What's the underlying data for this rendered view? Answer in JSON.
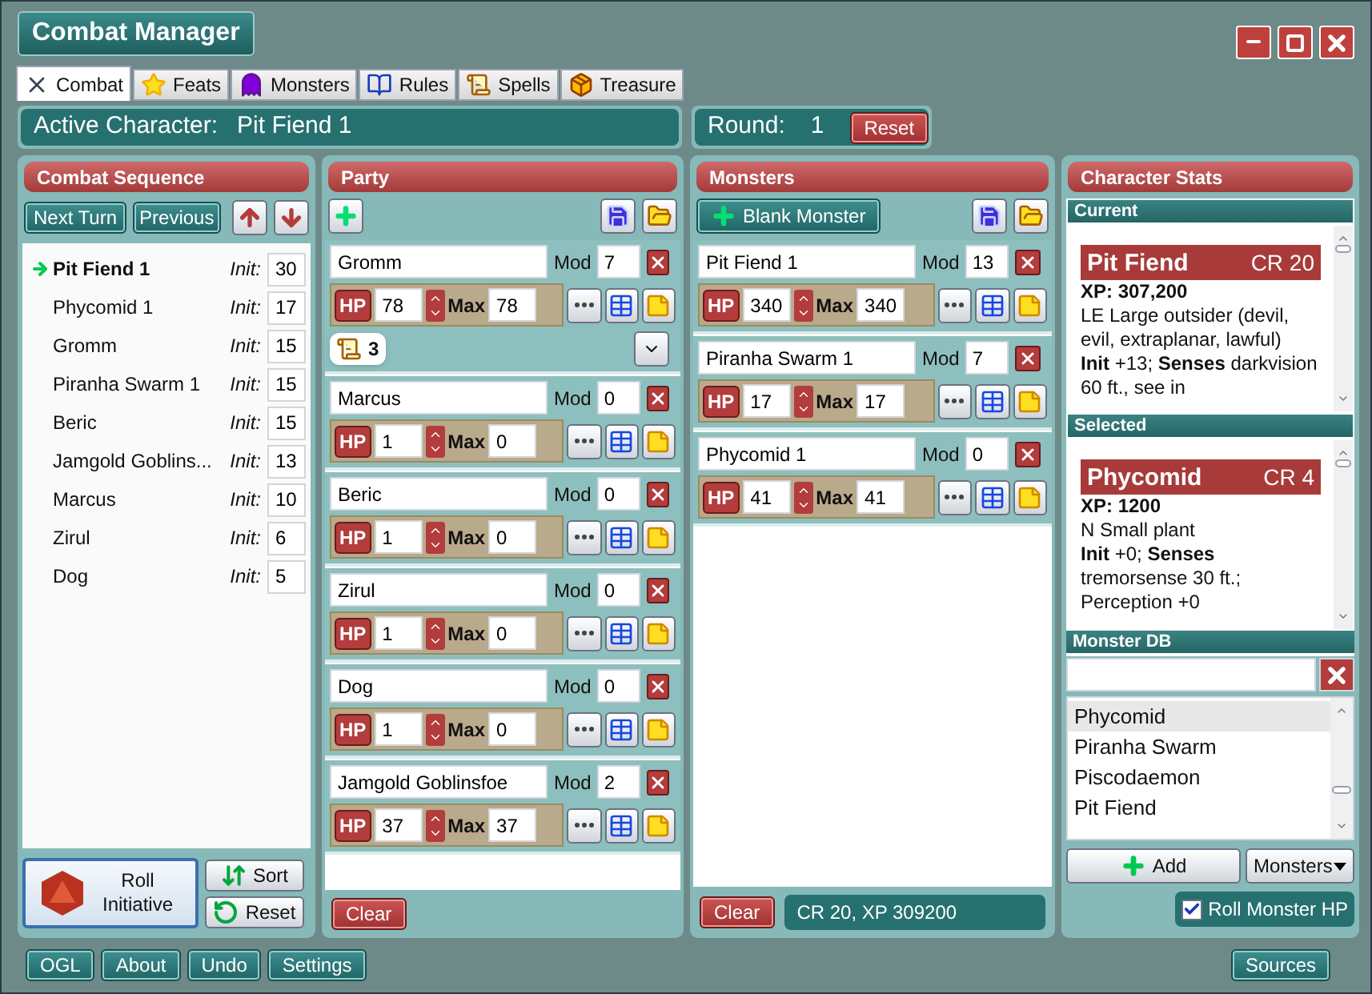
{
  "window": {
    "title": "Combat Manager"
  },
  "tabs": [
    {
      "label": "Combat",
      "selected": true
    },
    {
      "label": "Feats",
      "selected": false
    },
    {
      "label": "Monsters",
      "selected": false
    },
    {
      "label": "Rules",
      "selected": false
    },
    {
      "label": "Spells",
      "selected": false
    },
    {
      "label": "Treasure",
      "selected": false
    }
  ],
  "active_character": {
    "label": "Active Character:",
    "name": "Pit Fiend 1"
  },
  "round": {
    "label": "Round:",
    "value": "1",
    "reset": "Reset"
  },
  "combat_sequence": {
    "title": "Combat Sequence",
    "next": "Next Turn",
    "previous": "Previous",
    "entries": [
      {
        "name": "Pit Fiend 1",
        "init_label": "Init:",
        "init": "30",
        "selected": true
      },
      {
        "name": "Phycomid 1",
        "init_label": "Init:",
        "init": "17",
        "selected": false
      },
      {
        "name": "Gromm",
        "init_label": "Init:",
        "init": "15",
        "selected": false
      },
      {
        "name": "Piranha Swarm 1",
        "init_label": "Init:",
        "init": "15",
        "selected": false
      },
      {
        "name": "Beric",
        "init_label": "Init:",
        "init": "15",
        "selected": false
      },
      {
        "name": "Jamgold Goblins...",
        "init_label": "Init:",
        "init": "13",
        "selected": false
      },
      {
        "name": "Marcus",
        "init_label": "Init:",
        "init": "10",
        "selected": false
      },
      {
        "name": "Zirul",
        "init_label": "Init:",
        "init": "6",
        "selected": false
      },
      {
        "name": "Dog",
        "init_label": "Init:",
        "init": "5",
        "selected": false
      }
    ],
    "roll": "Roll Initiative",
    "sort": "Sort",
    "reset": "Reset"
  },
  "party": {
    "title": "Party",
    "members": [
      {
        "name": "Gromm",
        "mod_label": "Mod",
        "mod": "7",
        "hp_label": "HP",
        "hp": "78",
        "max_label": "Max",
        "max": "78",
        "conditions": "3"
      },
      {
        "name": "Marcus",
        "mod_label": "Mod",
        "mod": "0",
        "hp_label": "HP",
        "hp": "1",
        "max_label": "Max",
        "max": "0"
      },
      {
        "name": "Beric",
        "mod_label": "Mod",
        "mod": "0",
        "hp_label": "HP",
        "hp": "1",
        "max_label": "Max",
        "max": "0"
      },
      {
        "name": "Zirul",
        "mod_label": "Mod",
        "mod": "0",
        "hp_label": "HP",
        "hp": "1",
        "max_label": "Max",
        "max": "0"
      },
      {
        "name": "Dog",
        "mod_label": "Mod",
        "mod": "0",
        "hp_label": "HP",
        "hp": "1",
        "max_label": "Max",
        "max": "0"
      },
      {
        "name": "Jamgold Goblinsfoe",
        "mod_label": "Mod",
        "mod": "2",
        "hp_label": "HP",
        "hp": "37",
        "max_label": "Max",
        "max": "37"
      }
    ],
    "clear": "Clear"
  },
  "monsters": {
    "title": "Monsters",
    "blank_monster": "Blank Monster",
    "members": [
      {
        "name": "Pit Fiend 1",
        "mod_label": "Mod",
        "mod": "13",
        "hp_label": "HP",
        "hp": "340",
        "max_label": "Max",
        "max": "340"
      },
      {
        "name": "Piranha Swarm 1",
        "mod_label": "Mod",
        "mod": "7",
        "hp_label": "HP",
        "hp": "17",
        "max_label": "Max",
        "max": "17"
      },
      {
        "name": "Phycomid 1",
        "mod_label": "Mod",
        "mod": "0",
        "hp_label": "HP",
        "hp": "41",
        "max_label": "Max",
        "max": "41"
      }
    ],
    "clear": "Clear",
    "summary": "CR 20, XP 309200"
  },
  "character_stats": {
    "title": "Character Stats",
    "current": {
      "heading": "Current",
      "name": "Pit Fiend",
      "cr": "CR 20",
      "xp": "XP: 307,200",
      "type": "LE Large outsider (devil, evil, extraplanar, lawful)",
      "senses": "**Init** +13; **Senses** darkvision 60 ft., see in"
    },
    "selected": {
      "heading": "Selected",
      "name": "Phycomid",
      "cr": "CR 4",
      "xp": "XP: 1200",
      "type": "N Small plant",
      "senses": "**Init** +0; **Senses** tremorsense 30 ft.; Perception +0"
    },
    "monster_db": {
      "heading": "Monster DB",
      "list": [
        {
          "name": "Phycomid",
          "selected": true
        },
        {
          "name": "Piranha Swarm",
          "selected": false
        },
        {
          "name": "Piscodaemon",
          "selected": false
        },
        {
          "name": "Pit Fiend",
          "selected": false
        }
      ],
      "add": "Add",
      "source": "Monsters",
      "roll_hp": {
        "label": "Roll Monster HP",
        "checked": true
      }
    }
  },
  "footer": {
    "buttons": [
      "OGL",
      "About",
      "Undo",
      "Settings"
    ],
    "sources": "Sources"
  }
}
